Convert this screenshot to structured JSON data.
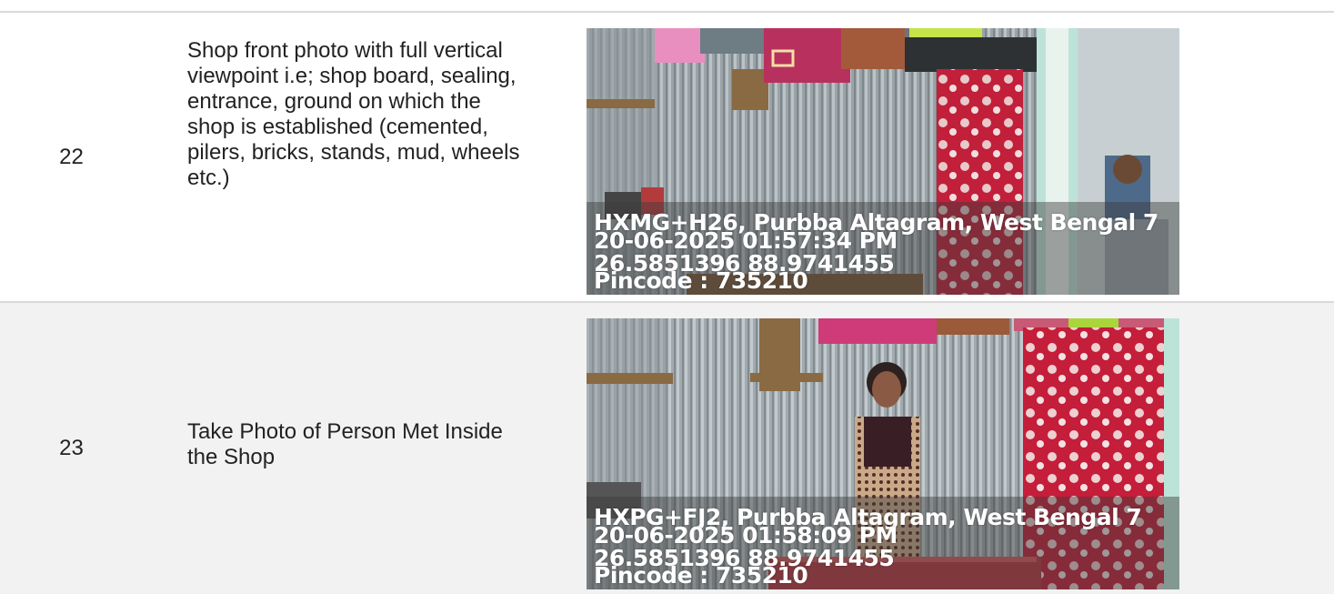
{
  "rows": [
    {
      "number": "22",
      "description": "Shop front photo with full vertical viewpoint i.e; shop board, sealing, entrance, ground on which the shop is established (cemented, pilers, bricks, stands, mud, wheels etc.)",
      "photo": {
        "address": "HXMG+H26, Purbba Altagram, West Bengal 7",
        "datetime": "20-06-2025 01:57:34 PM",
        "coords": "26.5851396 88.9741455",
        "pincode": "Pincode : 735210"
      }
    },
    {
      "number": "23",
      "description": "Take Photo of Person Met Inside the Shop",
      "photo": {
        "address": "HXPG+FJ2, Purbba Altagram, West Bengal 7",
        "datetime": "20-06-2025 01:58:09 PM",
        "coords": "26.5851396 88.9741455",
        "pincode": "Pincode : 735210"
      }
    }
  ]
}
